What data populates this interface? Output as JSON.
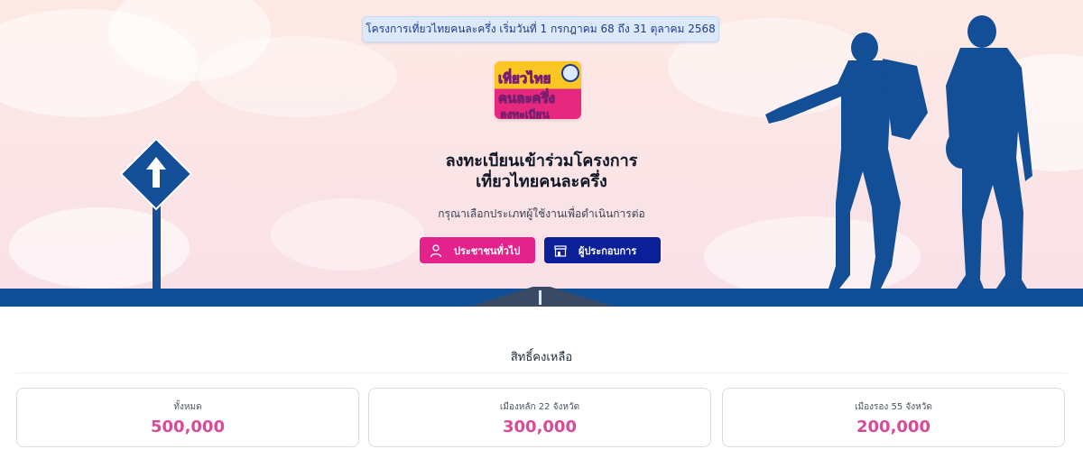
{
  "banner": {
    "text": "โครงการเที่ยวไทยคนละครึ่ง เริ่มวันที่ 1 กรกฎาคม 68 ถึง 31 ตุลาคม 2568"
  },
  "logo": {
    "line1": "เที่ยวไทย",
    "line2": "คนละครึ่ง",
    "line3": "ลงทะเบียน"
  },
  "hero": {
    "title_line1": "ลงทะเบียนเข้าร่วมโครงการ",
    "title_line2": "เที่ยวไทยคนละครึ่ง",
    "subtitle": "กรุณาเลือกประเภทผู้ใช้งานเพื่อดำเนินการต่อ"
  },
  "buttons": {
    "citizen": {
      "label": "ประชาชนทั่วไป",
      "icon": "user-icon",
      "color": "#e3238b"
    },
    "business": {
      "label": "ผู้ประกอบการ",
      "icon": "store-icon",
      "color": "#0b1f99"
    }
  },
  "quota": {
    "title": "สิทธิ์คงเหลือ",
    "cards": [
      {
        "label": "ทั้งหมด",
        "value": "500,000"
      },
      {
        "label": "เมืองหลัก 22 จังหวัด",
        "value": "300,000"
      },
      {
        "label": "เมืองรอง 55 จังหวัด",
        "value": "200,000"
      }
    ]
  },
  "colors": {
    "accent_pink": "#d94a98",
    "road_blue": "#0e4f97",
    "silhouette": "#124f96"
  }
}
